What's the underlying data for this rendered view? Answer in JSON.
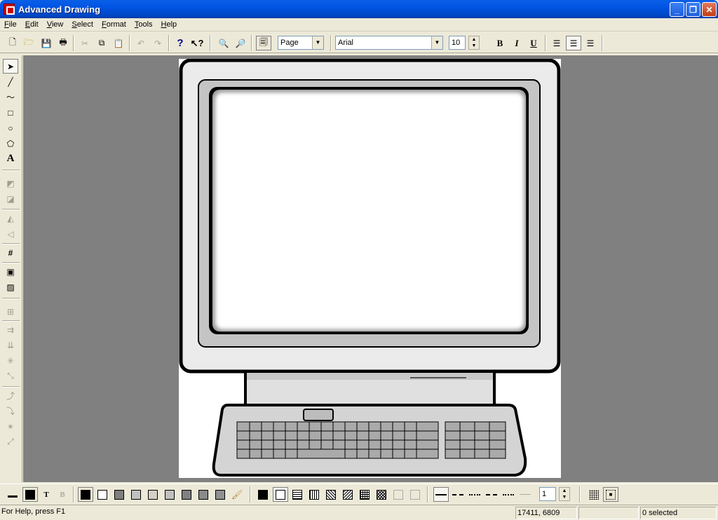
{
  "window": {
    "title": "Advanced Drawing",
    "controls": [
      "minimize",
      "restore",
      "close"
    ]
  },
  "menu": [
    "File",
    "Edit",
    "View",
    "Select",
    "Format",
    "Tools",
    "Help"
  ],
  "toolbar": {
    "zoom_value": "Page",
    "font_name": "Arial",
    "font_size": "10"
  },
  "status": {
    "help_text": "For Help, press F1",
    "coords": "17411, 6809",
    "selection": "0 selected"
  },
  "line_width": "1",
  "colors": {
    "page": "#ffffff",
    "workspace": "#808080",
    "monitor_gray": "#c0c0c0",
    "outline": "#000000"
  }
}
